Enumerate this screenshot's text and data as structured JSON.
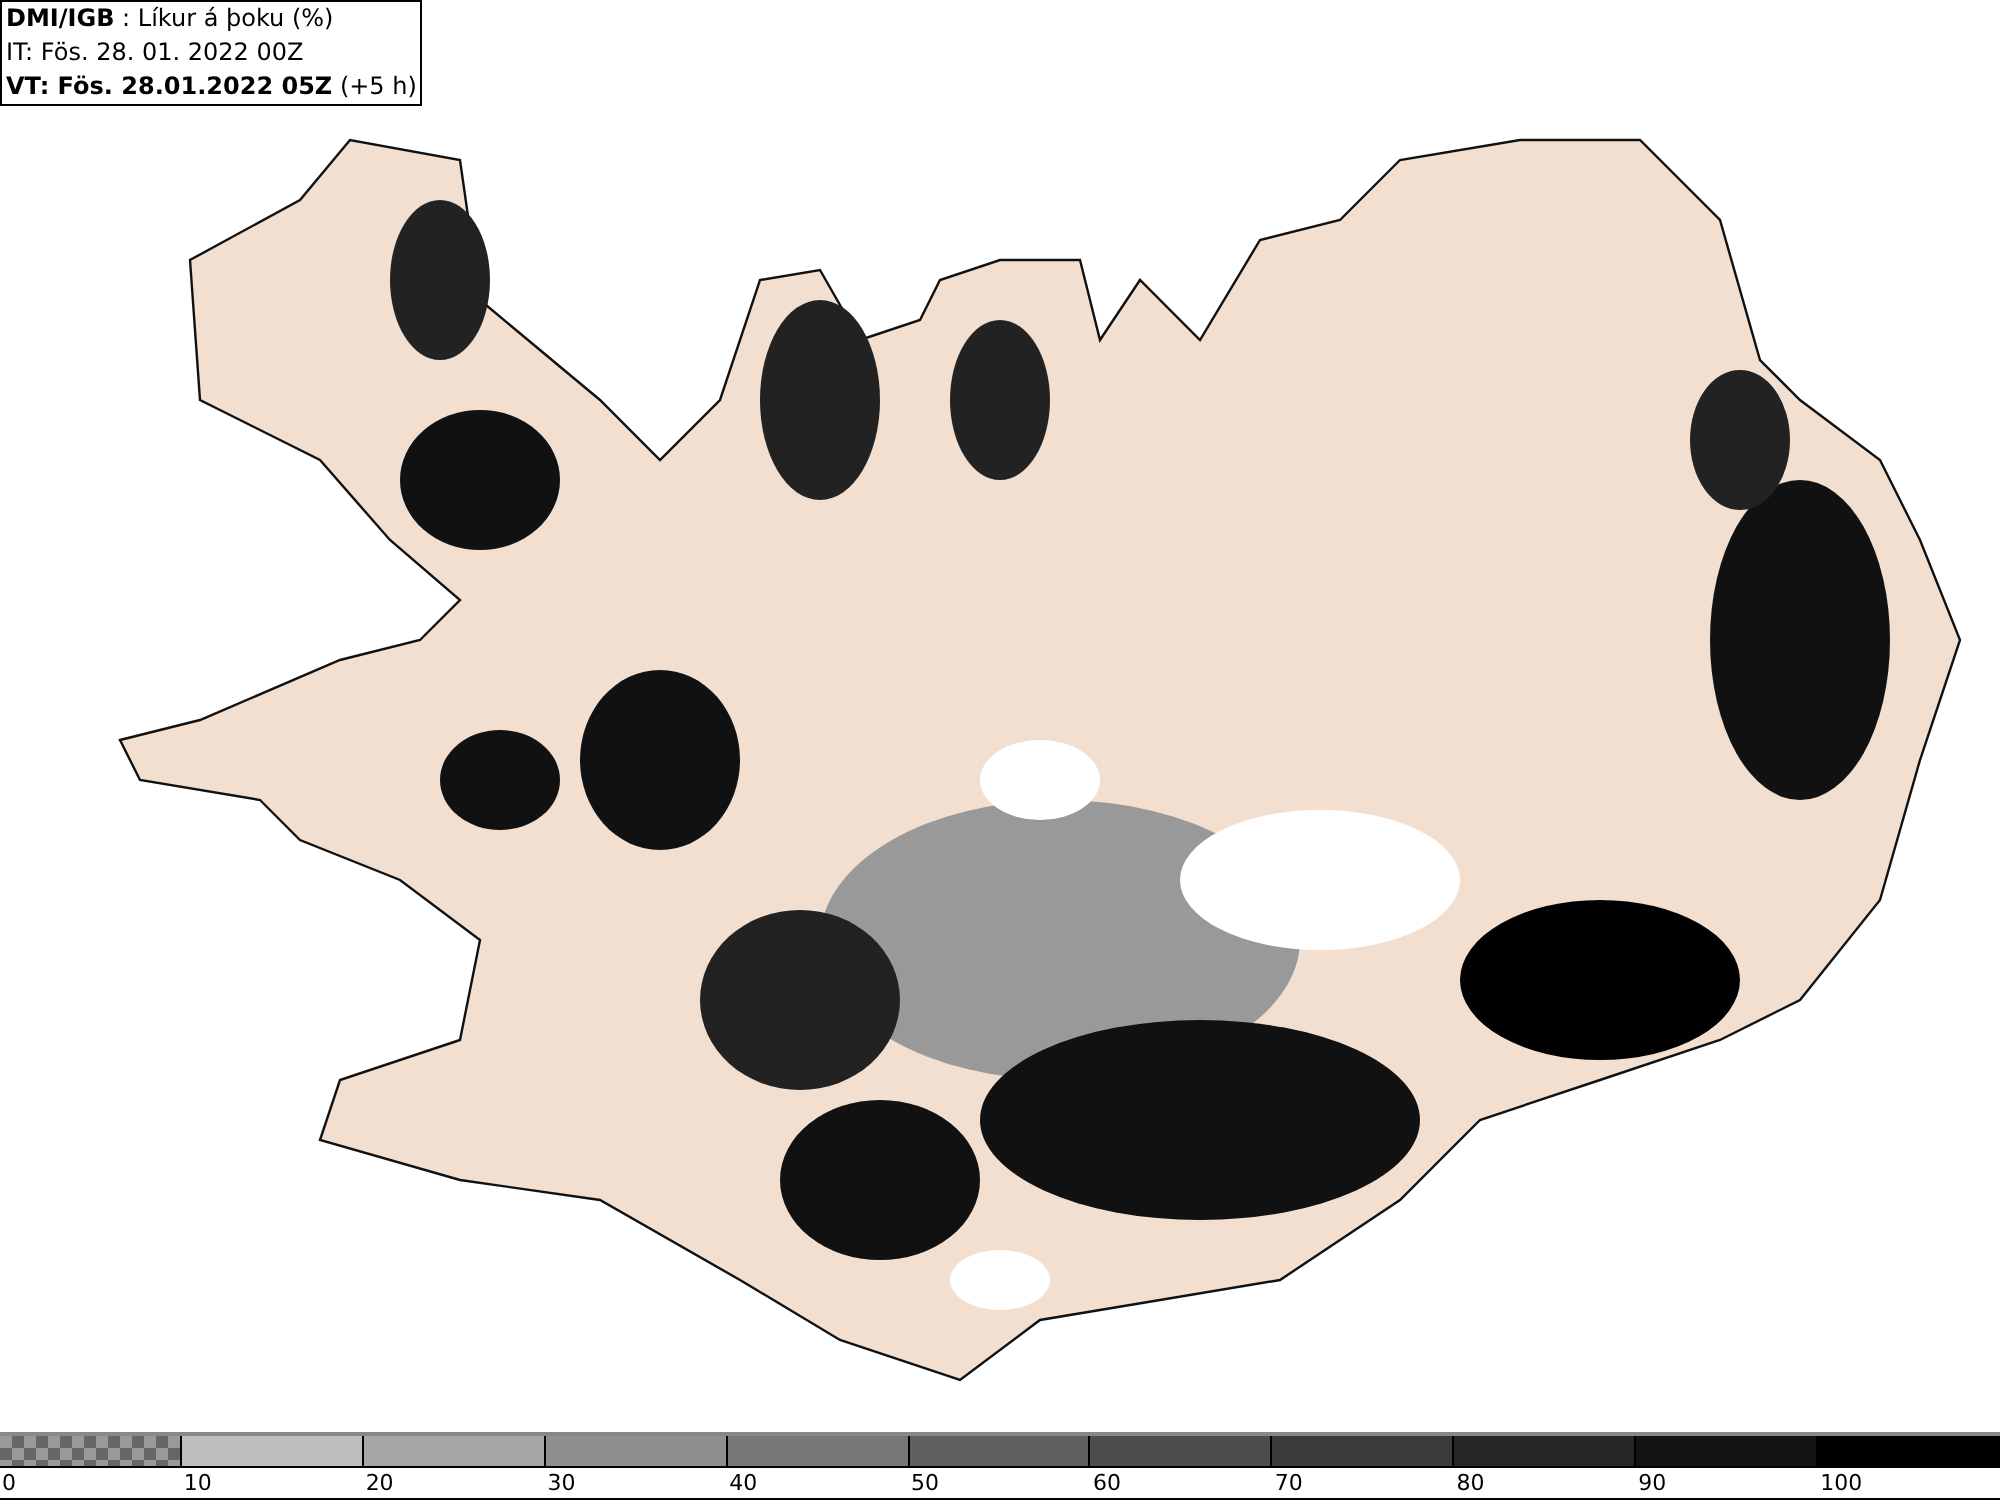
{
  "header": {
    "source_line": "**DMI/IGB** : Líkur á þoku (%)",
    "init_time": "IT: Fös. 28. 01. 2022 00Z",
    "valid_line": "**VT: Fös. 28.01.2022 05Z** (+5 h)"
  },
  "legend": {
    "segments": [
      {
        "kind": "checker",
        "color": "#666666"
      },
      {
        "kind": "solid",
        "color": "#bdbdbd"
      },
      {
        "kind": "solid",
        "color": "#a6a6a6"
      },
      {
        "kind": "solid",
        "color": "#8f8f8f"
      },
      {
        "kind": "solid",
        "color": "#777777"
      },
      {
        "kind": "solid",
        "color": "#606060"
      },
      {
        "kind": "solid",
        "color": "#4d4d4d"
      },
      {
        "kind": "solid",
        "color": "#3b3b3b"
      },
      {
        "kind": "solid",
        "color": "#262626"
      },
      {
        "kind": "solid",
        "color": "#141414"
      },
      {
        "kind": "solid",
        "color": "#000000"
      }
    ],
    "ticks": [
      "0",
      "10",
      "20",
      "30",
      "40",
      "50",
      "60",
      "70",
      "80",
      "90",
      "100"
    ]
  }
}
